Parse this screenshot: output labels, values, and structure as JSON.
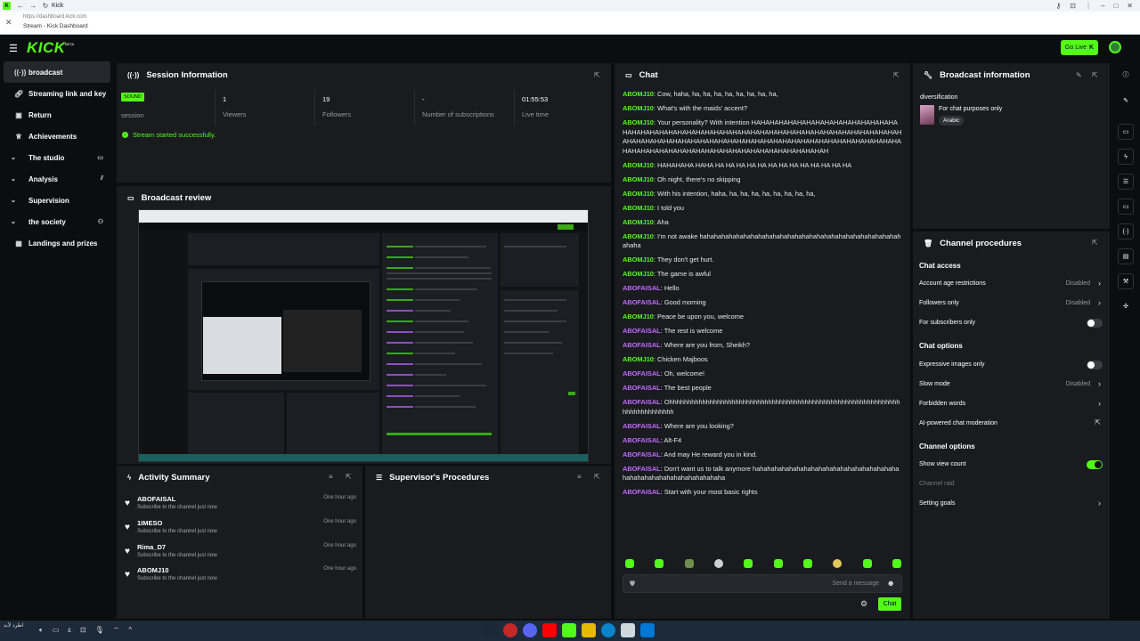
{
  "browser": {
    "tab_title": "Kick",
    "url": "https://dashboard.kick.com",
    "page_title": "Stream - Kick Dashboard"
  },
  "topbar": {
    "logo": "KICK",
    "beta": "BETA",
    "go_live": "Go Live"
  },
  "sidebar": {
    "items": [
      {
        "label": "broadcast"
      },
      {
        "label": "Streaming link and key"
      },
      {
        "label": "Return"
      },
      {
        "label": "Achievements"
      },
      {
        "label": "The studio"
      },
      {
        "label": "Analysis"
      },
      {
        "label": "Supervision"
      },
      {
        "label": "the society"
      },
      {
        "label": "Landings and prizes"
      }
    ]
  },
  "session": {
    "title": "Session Information",
    "badge": "SOUND",
    "session_label": "session",
    "stats": [
      {
        "value": "1",
        "label": "Viewers"
      },
      {
        "value": "19",
        "label": "Followers"
      },
      {
        "value": "-",
        "label": "Number of subscriptions"
      },
      {
        "value": "01:55:53",
        "label": "Live time"
      }
    ],
    "status": "Stream started successfully."
  },
  "review": {
    "title": "Broadcast review"
  },
  "activity": {
    "title": "Activity Summary",
    "items": [
      {
        "name": "ABOFAISAL",
        "sub": "Subscribe to the channel just now",
        "time": "One hour ago"
      },
      {
        "name": "1IMESO",
        "sub": "Subscribe to the channel just now",
        "time": "One hour ago"
      },
      {
        "name": "Rima_D7",
        "sub": "Subscribe to the channel just now",
        "time": "One hour ago"
      },
      {
        "name": "ABOMJ10",
        "sub": "Subscribe to the channel just now",
        "time": "One hour ago"
      }
    ]
  },
  "supervisor": {
    "title": "Supervisor's Procedures"
  },
  "chat": {
    "title": "Chat",
    "messages": [
      {
        "user": "ABOMJ10",
        "text": "Cow, haha, ha, ha, ha, ha, ha, ha, ha, ha,"
      },
      {
        "user": "ABOMJ10",
        "text": "What's with the maids' accent?"
      },
      {
        "user": "ABOMJ10",
        "text": "Your personality? With intention HAHAHAHAHAHAHAHAHAHAHAHAHAHAHAHAHAHAHAHAHAHAHAHAHAHAHAHAHAHAHAHAHAHAHAHAHAHAHAHAHAHAHAHAHAHAHAHAHAHAHAHAHAHAHAHAHAHAHAHAHAHAHAHAHAHAHAHAHAHAHAHAHAHAHAHAHAHAHAHAHAHAHAHAHAHAHAHAHAHAHAHAHAHAHAHAHAHAHAH"
      },
      {
        "user": "ABOMJ10",
        "text": "HAHAHAHA HAHA HA HA HA HA HA HA HA HA HA HA HA HA HA"
      },
      {
        "user": "ABOMJ10",
        "text": "Oh night, there's no skipping"
      },
      {
        "user": "ABOMJ10",
        "text": "With his intention, haha, ha, ha, ha, ha, ha, ha, ha, ha,"
      },
      {
        "user": "ABOMJ10",
        "text": "I told you"
      },
      {
        "user": "ABOMJ10",
        "text": "Aha"
      },
      {
        "user": "ABOMJ10",
        "text": "I'm not awake hahahahahahahahahahahahahahahahahahahahahahahahahahahahahaha"
      },
      {
        "user": "ABOMJ10",
        "text": "They don't get hurt."
      },
      {
        "user": "ABOMJ10",
        "text": "The game is awful"
      },
      {
        "user": "ABOFAISAL",
        "text": "Hello"
      },
      {
        "user": "ABOFAISAL",
        "text": "Good morning"
      },
      {
        "user": "ABOMJ10",
        "text": "Peace be upon you, welcome"
      },
      {
        "user": "ABOFAISAL",
        "text": "The rest is welcome"
      },
      {
        "user": "ABOFAISAL",
        "text": "Where are you from, Sheikh?"
      },
      {
        "user": "ABOMJ10",
        "text": "Chicken Majboos"
      },
      {
        "user": "ABOFAISAL",
        "text": "Oh, welcome!"
      },
      {
        "user": "ABOFAISAL",
        "text": "The best people"
      },
      {
        "user": "ABOFAISAL",
        "text": "Ohhhhhhhhhhhhhhhhhhhhhhhhhhhhhhhhhhhhhhhhhhhhhhhhhhhhhhhhhhhhhhhhhhhhhhhhhhhhh"
      },
      {
        "user": "ABOFAISAL",
        "text": "Where are you looking?"
      },
      {
        "user": "ABOFAISAL",
        "text": "Alt-F4"
      },
      {
        "user": "ABOFAISAL",
        "text": "And may He reward you in kind."
      },
      {
        "user": "ABOFAISAL",
        "text": "Don't want us to talk anymore hahahahahahahahahahahahahahahahahahahahahahahahahahahahahahahahahaha"
      },
      {
        "user": "ABOFAISAL",
        "text": "Start with your most basic rights"
      }
    ],
    "placeholder": "Send a message",
    "send_label": "Chat"
  },
  "broadcast_info": {
    "title": "Broadcast information",
    "category": "diversification",
    "for_chat": "For chat purposes only",
    "language": "Arabic"
  },
  "procedures": {
    "title": "Channel procedures",
    "chat_access": "Chat access",
    "account_age": "Account age restrictions",
    "account_age_status": "Disabled",
    "followers_only": "Followers only",
    "followers_only_status": "Disabled",
    "subscribers_only": "For subscribers only",
    "chat_options": "Chat options",
    "expressive_images": "Expressive images only",
    "slow_mode": "Slow mode",
    "slow_mode_status": "Disabled",
    "forbidden_words": "Forbidden words",
    "ai_moderation": "AI-powered chat moderation",
    "channel_options": "Channel options",
    "show_view_count": "Show view count",
    "channel_raid": "Channel raid",
    "setting_goals": "Setting goals"
  },
  "taskbar": {
    "left_text": "اطرد\nلأبد"
  },
  "colors": {
    "accent": "#53fc18",
    "purple_user": "#c26bff",
    "panel": "#191b1f",
    "background": "#0b0e0f"
  }
}
